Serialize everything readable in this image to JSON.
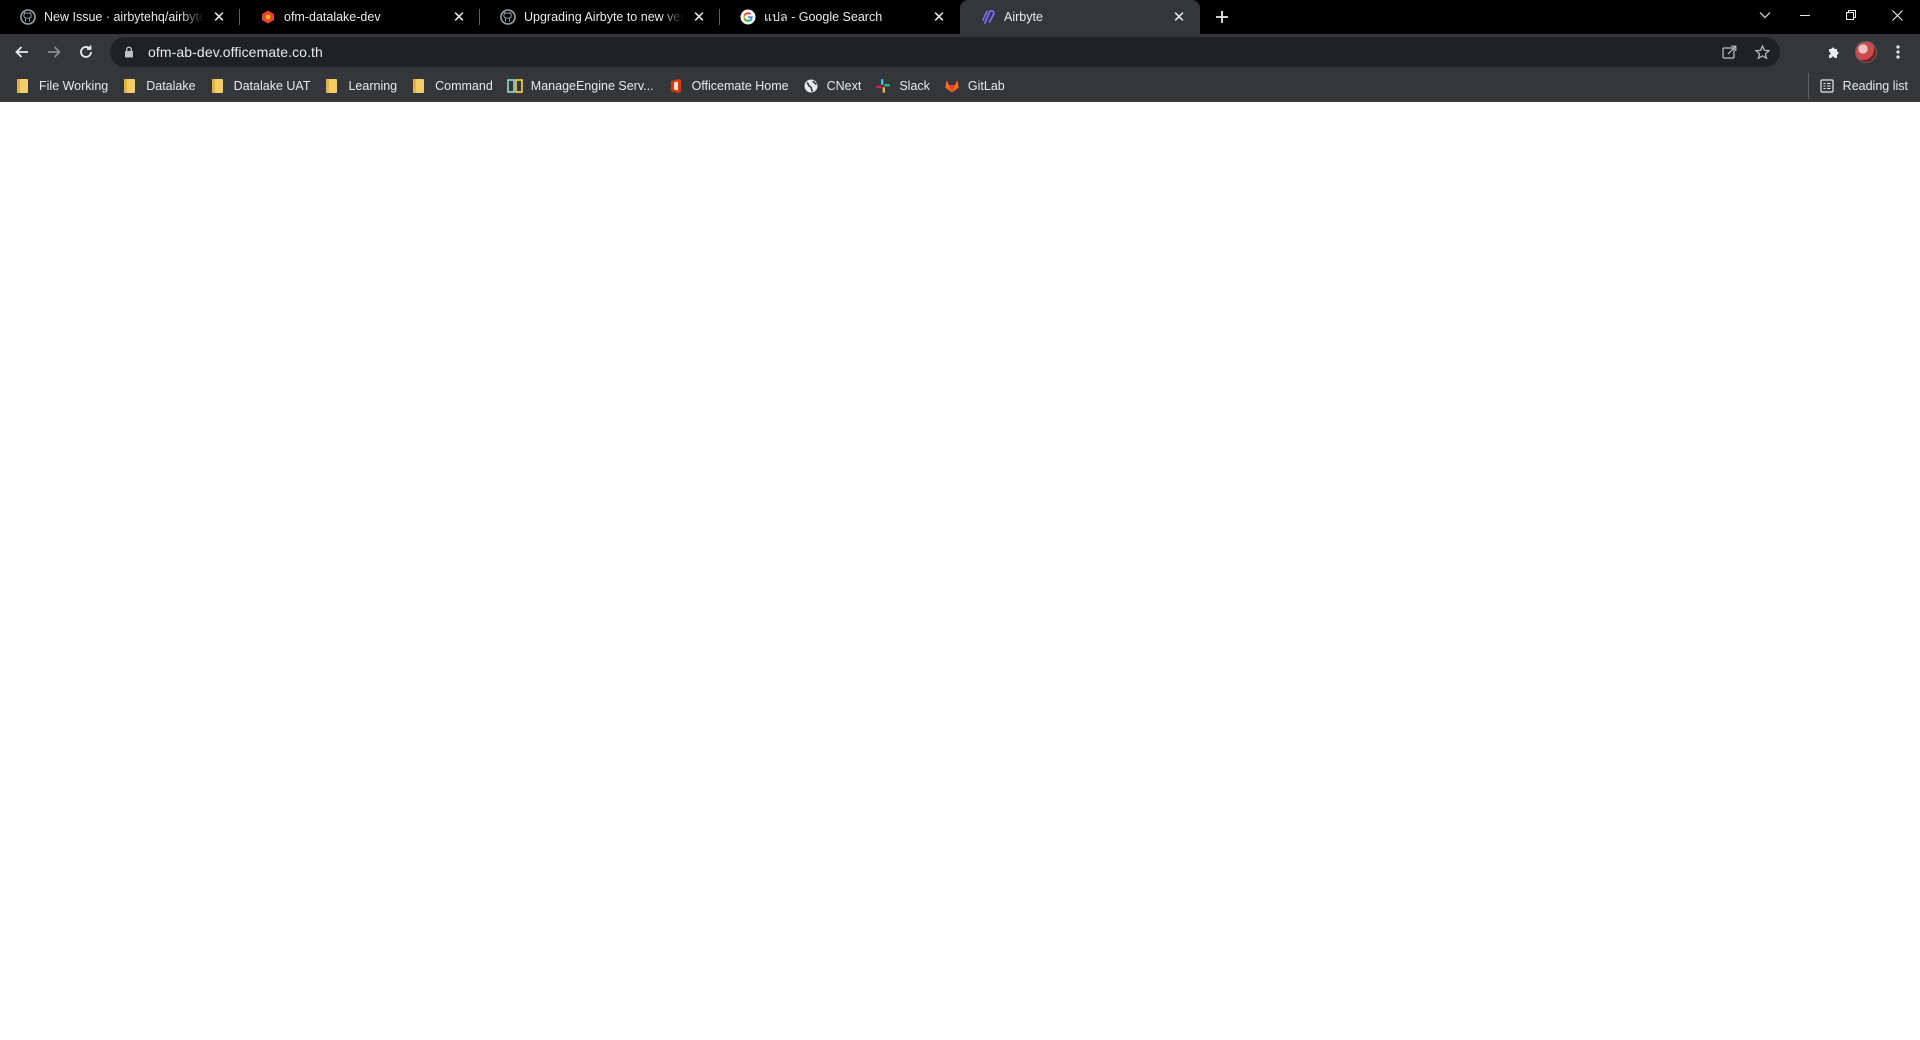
{
  "tabs": [
    {
      "title": "New Issue · airbytehq/airbyte",
      "favicon": "github-icon"
    },
    {
      "title": "ofm-datalake-dev",
      "favicon": "gcp-icon"
    },
    {
      "title": "Upgrading Airbyte to new version",
      "favicon": "github-icon"
    },
    {
      "title": "แปล - Google Search",
      "favicon": "google-icon"
    },
    {
      "title": "Airbyte",
      "favicon": "airbyte-icon",
      "active": true
    }
  ],
  "address_bar": {
    "url": "ofm-ab-dev.officemate.co.th"
  },
  "bookmarks": [
    {
      "label": "File Working",
      "icon": "folder-icon"
    },
    {
      "label": "Datalake",
      "icon": "folder-icon"
    },
    {
      "label": "Datalake UAT",
      "icon": "folder-icon"
    },
    {
      "label": "Learning",
      "icon": "folder-icon"
    },
    {
      "label": "Command",
      "icon": "folder-icon"
    },
    {
      "label": "ManageEngine Serv...",
      "icon": "manageengine-icon"
    },
    {
      "label": "Officemate Home",
      "icon": "office-icon"
    },
    {
      "label": "CNext",
      "icon": "globe-icon"
    },
    {
      "label": "Slack",
      "icon": "slack-icon"
    },
    {
      "label": "GitLab",
      "icon": "gitlab-icon"
    }
  ],
  "reading_list": {
    "label": "Reading list"
  },
  "colors": {
    "tabstrip_bg": "#000000",
    "toolbar_bg": "#35363a",
    "omnibox_bg": "#202124",
    "text": "#e8eaed",
    "folder": "#f5cc65",
    "page_bg": "#ffffff"
  }
}
